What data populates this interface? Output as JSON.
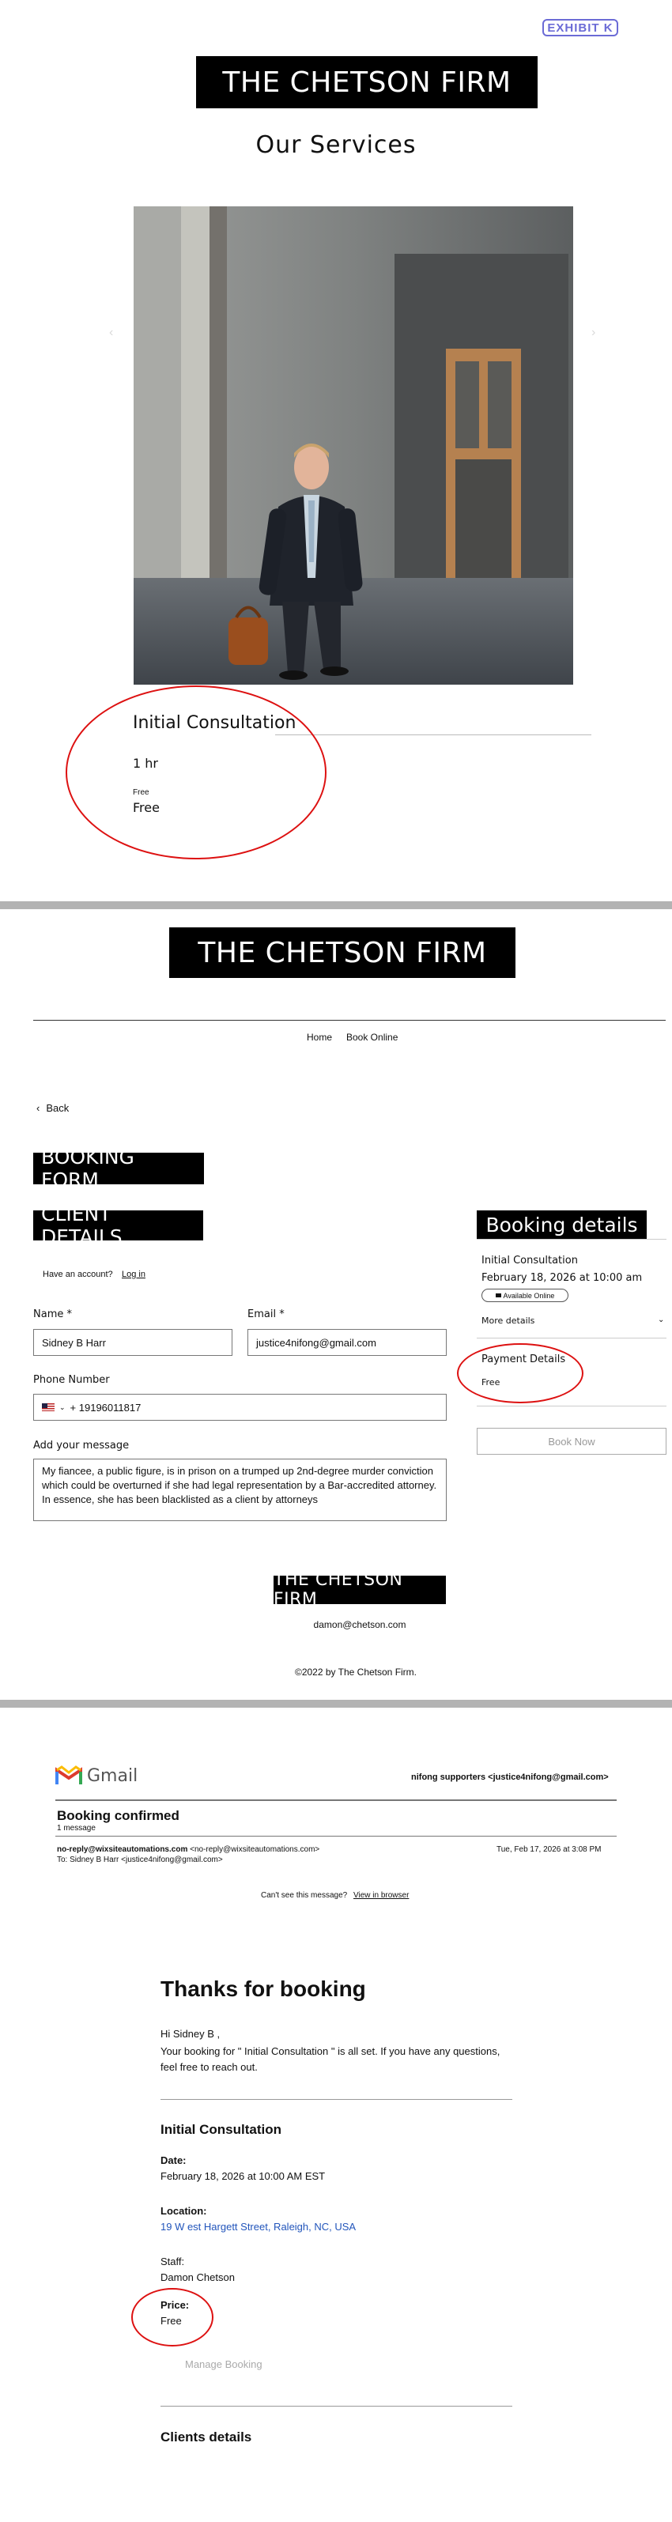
{
  "exhibit": "EXHIBIT K",
  "section1": {
    "firm_name": "THE CHETSON FIRM",
    "heading": "Our  Services",
    "service_title": "Initial Consultation",
    "duration": "1 hr",
    "price_small": "Free",
    "price": "Free"
  },
  "section2": {
    "firm_name": "THE CHETSON FIRM",
    "nav": [
      "Home",
      "Book Online"
    ],
    "back": "Back",
    "booking_form": "BOOKING FORM",
    "client_details": "CLIENT DETAILS",
    "have_account": "Have an account?",
    "login": "Log in",
    "name_label": "Name *",
    "name_value": "Sidney B Harr",
    "email_label": "Email *",
    "email_value": "justice4nifong@gmail.com",
    "phone_label": "Phone Number",
    "phone_value": "+ 19196011817",
    "message_label": "Add your message",
    "message_value": "My fiancee, a public figure, is in prison on a trumped up 2nd-degree murder conviction which could be overturned if she had legal representation by a Bar-accredited attorney.  In essence, she has been blacklisted as a client by attorneys",
    "booking_details": "Booking details",
    "service": "Initial Consultation",
    "service_date": "February 18, 2026 at 10:00 am",
    "available": "Available Online",
    "more_details": "More details",
    "payment_details": "Payment Details",
    "payment_value": "Free",
    "book_now": "Book Now",
    "footer_firm": "THE CHETSON FIRM",
    "contact_email": "damon@chetson.com",
    "copyright": "©2022 by The Chetson Firm."
  },
  "section3": {
    "gmail": "Gmail",
    "account": "nifong supporters <justice4nifong@gmail.com>",
    "subject": "Booking confirmed",
    "message_count": "1 message",
    "from": "no-reply@wixsiteautomations.com",
    "from_addr": "<no-reply@wixsiteautomations.com>",
    "to": "To: Sidney B Harr <justice4nifong@gmail.com>",
    "date": "Tue, Feb 17, 2026 at 3:08 PM",
    "cant_see": "Can't see this message?",
    "view_browser": "View in browser",
    "thanks": "Thanks for booking",
    "hi": "Hi Sidney B ,",
    "para": "Your booking for \" Initial Consultation \" is all set. If you have any questions, feel free to reach out.",
    "service_title": "Initial Consultation",
    "date_label": "Date:",
    "date_value": "February 18, 2026 at 10:00      AM EST",
    "location_label": "Location:",
    "location_value": "19 W est Hargett Street, Raleigh, NC, USA",
    "staff_label": "Staff:",
    "staff_value": "Damon Chetson",
    "price_label": "Price:",
    "price_value": "Free",
    "manage": "Manage Booking",
    "clients": "Clients details"
  },
  "colors": {
    "annotation_red": "#dd1111",
    "exhibit_blue": "#6b6bd6",
    "link_blue": "#2255bb"
  }
}
